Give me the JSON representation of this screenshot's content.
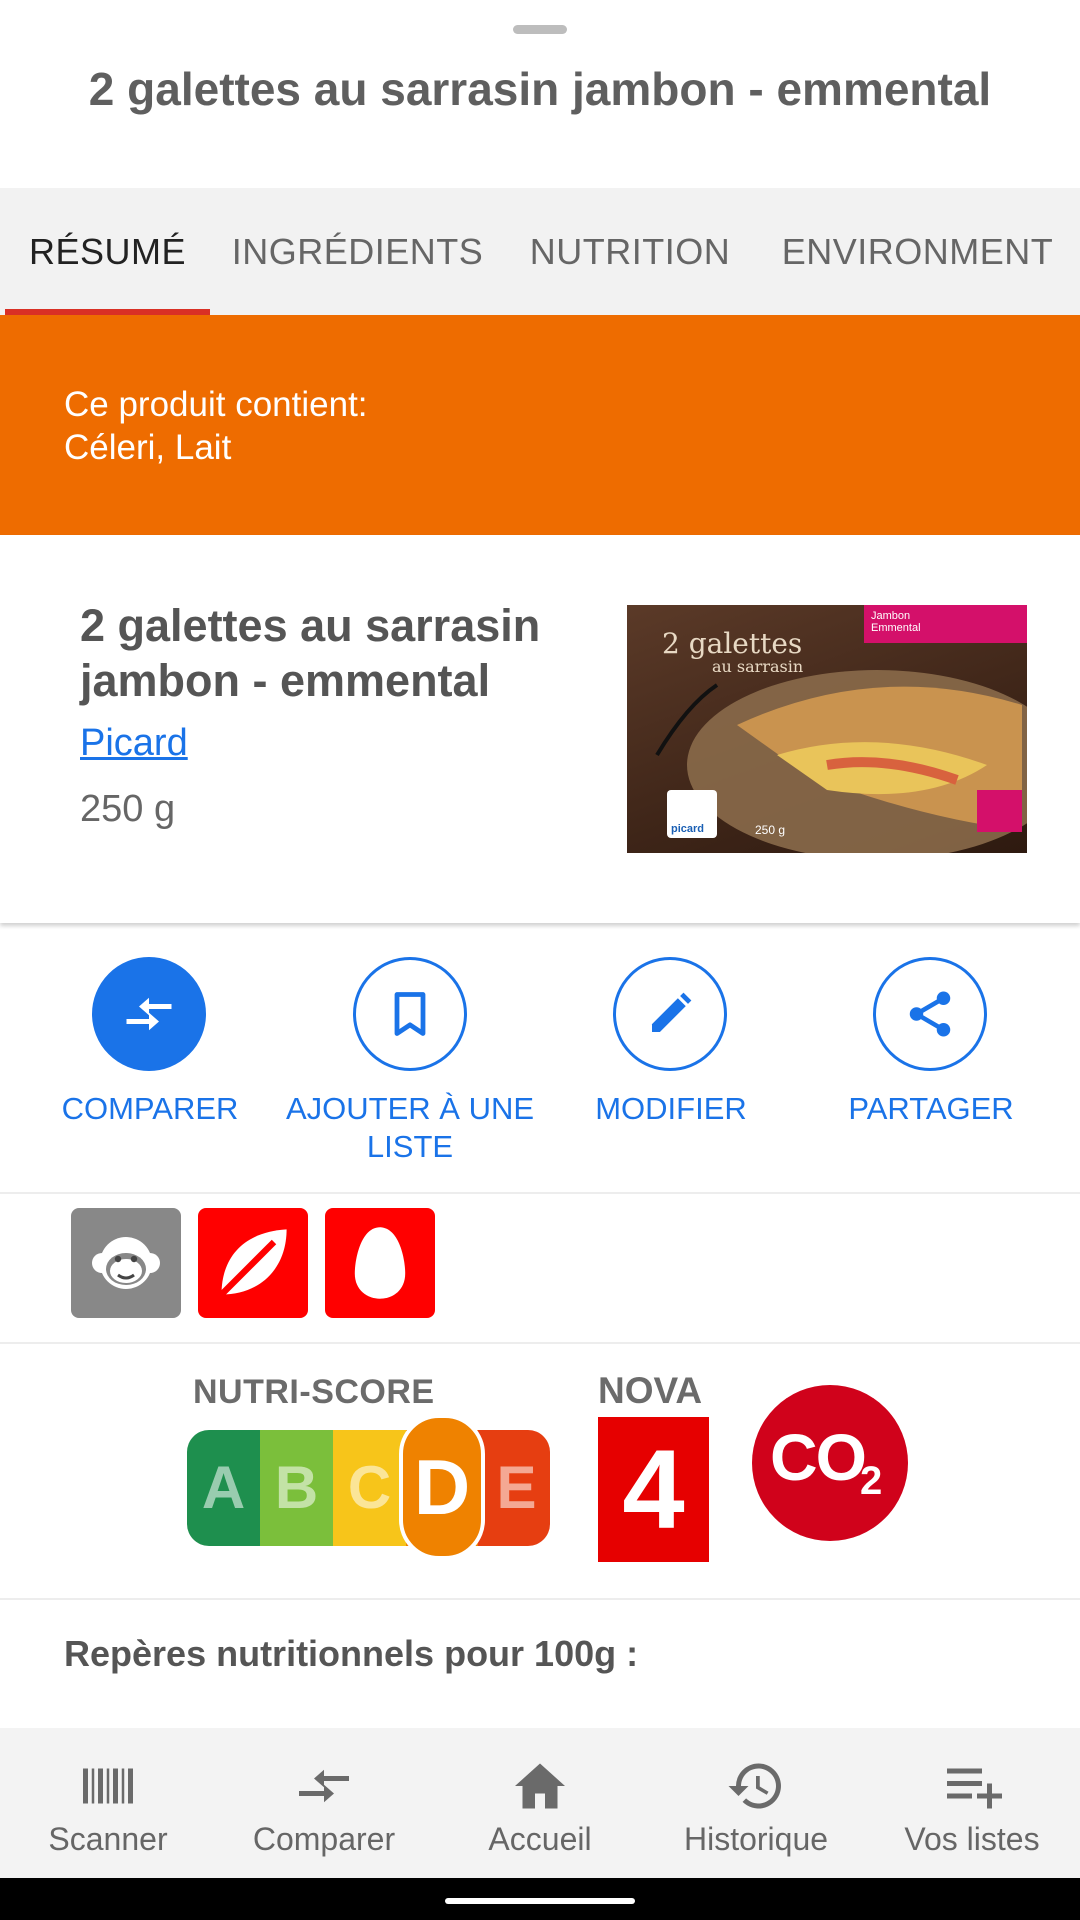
{
  "sheet": {
    "title": "2 galettes au sarrasin jambon - emmental"
  },
  "tabs": [
    {
      "label": "RÉSUMÉ",
      "active": true
    },
    {
      "label": "INGRÉDIENTS",
      "active": false
    },
    {
      "label": "NUTRITION",
      "active": false
    },
    {
      "label": "ENVIRONMENT",
      "active": false
    }
  ],
  "allergens": {
    "heading": "Ce produit contient:",
    "list": "Céleri, Lait",
    "color": "#ee6c00"
  },
  "product": {
    "name": "2 galettes au sarrasin jambon - emmental",
    "brand": "Picard",
    "quantity": "250 g",
    "photo": {
      "headline": "2 galettes",
      "subline": "au sarrasin",
      "flavor": "Jambon Emmental",
      "brand_mark": "picard",
      "weight": "250 g"
    }
  },
  "actions": [
    {
      "label": "COMPARER",
      "icon": "compare-arrows-icon"
    },
    {
      "label": "AJOUTER À UNE LISTE",
      "icon": "bookmark-icon"
    },
    {
      "label": "MODIFIER",
      "icon": "pencil-icon"
    },
    {
      "label": "PARTAGER",
      "icon": "share-icon"
    }
  ],
  "attributes": [
    {
      "icon": "palm-oil-monkey-icon",
      "color": "#888888"
    },
    {
      "icon": "vegan-leaf-icon",
      "color": "#ff0000"
    },
    {
      "icon": "vegetarian-egg-icon",
      "color": "#ff0000"
    }
  ],
  "scores": {
    "nutriscore": {
      "title": "NUTRI-SCORE",
      "grades": [
        "A",
        "B",
        "C",
        "D",
        "E"
      ],
      "selected": "D",
      "colors": [
        "#1e8f4e",
        "#7bbf3b",
        "#f7c51a",
        "#ef8200",
        "#e63e11"
      ]
    },
    "nova": {
      "title": "NOVA",
      "value": "4"
    },
    "co2": {
      "text": "CO",
      "subscript": "2"
    }
  },
  "reperes_title": "Repères nutritionnels pour 100g :",
  "bottom_nav": [
    {
      "label": "Scanner",
      "icon": "barcode-icon"
    },
    {
      "label": "Comparer",
      "icon": "compare-arrows-icon"
    },
    {
      "label": "Accueil",
      "icon": "home-icon"
    },
    {
      "label": "Historique",
      "icon": "history-icon"
    },
    {
      "label": "Vos listes",
      "icon": "playlist-add-icon"
    }
  ],
  "theme": {
    "accent": "#1a73e8",
    "tab_indicator": "#d93025"
  }
}
